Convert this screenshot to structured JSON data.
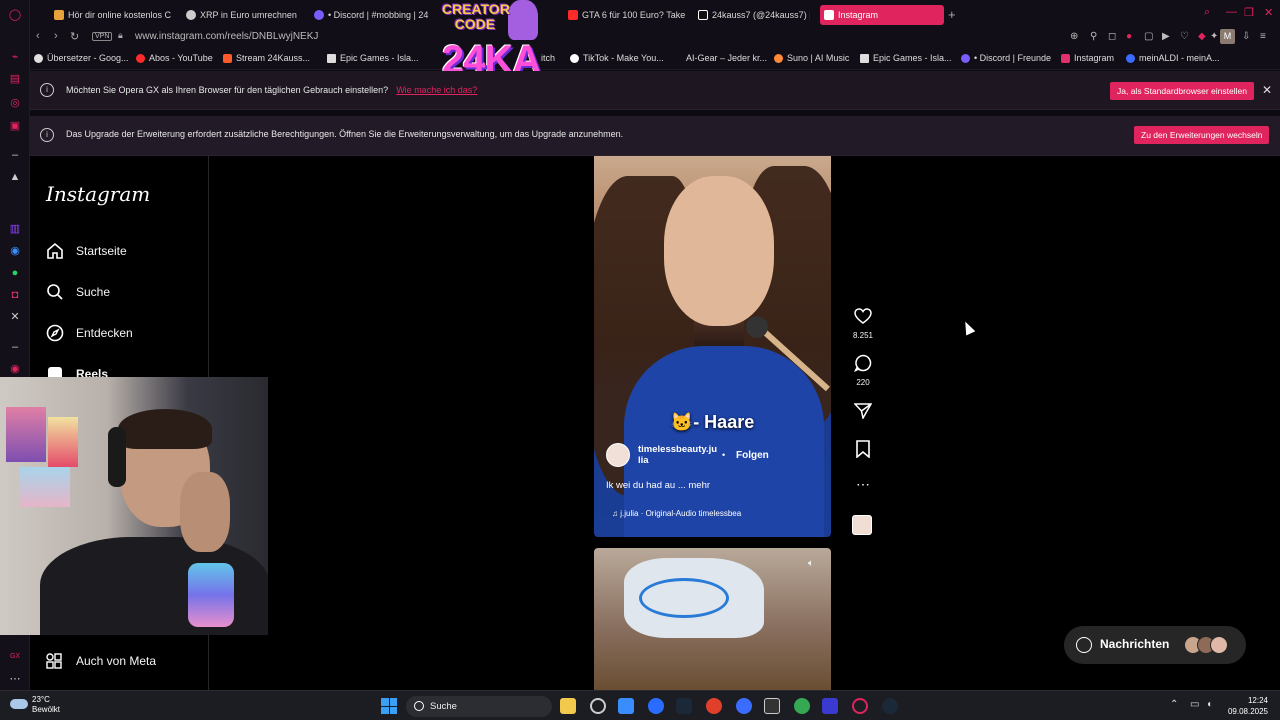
{
  "browser": {
    "tabs": [
      {
        "label": "Hör dir online kostenlos C",
        "color": "#e8a23a"
      },
      {
        "label": "XRP in Euro umrechnen",
        "color": "#cccccc"
      },
      {
        "label": "• Discord | #mobbing | 24",
        "color": "#7b5cff"
      },
      {
        "label": "GTA 6 für 100 Euro? Take",
        "color": "#ff2b2b"
      },
      {
        "label": "24kauss7 (@24kauss7) |",
        "color": "#ffffff"
      },
      {
        "label": "Instagram",
        "color": "#e1306c",
        "active": true
      }
    ],
    "url": "www.instagram.com/reels/DNBLwyjNEKJ",
    "vpn_label": "VPN",
    "profile_initial": "M",
    "bookmarks": [
      {
        "label": "Übersetzer - Goog...",
        "color": "#e0e0e0"
      },
      {
        "label": "Abos - YouTube",
        "color": "#ff2b2b"
      },
      {
        "label": "Stream 24Kauss...",
        "color": "#ff5a2b"
      },
      {
        "label": "Epic Games - Isla...",
        "color": "#dddddd"
      },
      {
        "label": "itch",
        "color": "#9a5cff"
      },
      {
        "label": "TikTok - Make You...",
        "color": "#ffffff"
      },
      {
        "label": "AI-Gear – Jeder kr...",
        "color": "#888888"
      },
      {
        "label": "Suno | AI Music",
        "color": "#ff8a3a"
      },
      {
        "label": "Epic Games - Isla...",
        "color": "#dddddd"
      },
      {
        "label": "• Discord | Freunde",
        "color": "#7b5cff"
      },
      {
        "label": "Instagram",
        "color": "#e1306c"
      },
      {
        "label": "meinALDI - meinA...",
        "color": "#3a6cff"
      }
    ]
  },
  "notices": {
    "default_browser": {
      "text": "Möchten Sie Opera GX als Ihren Browser für den täglichen Gebrauch einstellen?",
      "link": "Wie mache ich das?",
      "button": "Ja, als Standardbrowser einstellen",
      "close": "✕"
    },
    "extension": {
      "text": "Das Upgrade der Erweiterung erfordert zusätzliche Berechtigungen. Öffnen Sie die Erweiterungsverwaltung, um das Upgrade anzunehmen.",
      "button": "Zu den Erweiterungen wechseln"
    }
  },
  "overlay": {
    "creator_line1": "CREATOR",
    "creator_line2": "CODE",
    "creator_code": "24KA"
  },
  "instagram": {
    "logo": "Instagram",
    "nav": [
      {
        "label": "Startseite",
        "icon": "home-icon"
      },
      {
        "label": "Suche",
        "icon": "search-icon"
      },
      {
        "label": "Entdecken",
        "icon": "compass-icon"
      },
      {
        "label": "Reels",
        "icon": "reels-icon"
      }
    ],
    "meta_nav": "Auch von Meta",
    "reel": {
      "caption_emoji": "🐱",
      "caption": "- Haare",
      "username": "timelessbeauty.julia",
      "dot": "•",
      "follow": "Folgen",
      "description": "Ik wei du had au ... mehr",
      "audio_note": "♫",
      "audio": "j.julia · Original-Audio",
      "audio_user": "timelessbea"
    },
    "actions": {
      "likes": "8.251",
      "comments": "220"
    },
    "messages": "Nachrichten"
  },
  "taskbar": {
    "weather_temp": "23°C",
    "weather_desc": "Bewölkt",
    "search": "Suche",
    "time": "12:24",
    "date": "09.08.2025"
  },
  "colors": {
    "accent": "#e0245e",
    "ig_bg": "#000000"
  }
}
